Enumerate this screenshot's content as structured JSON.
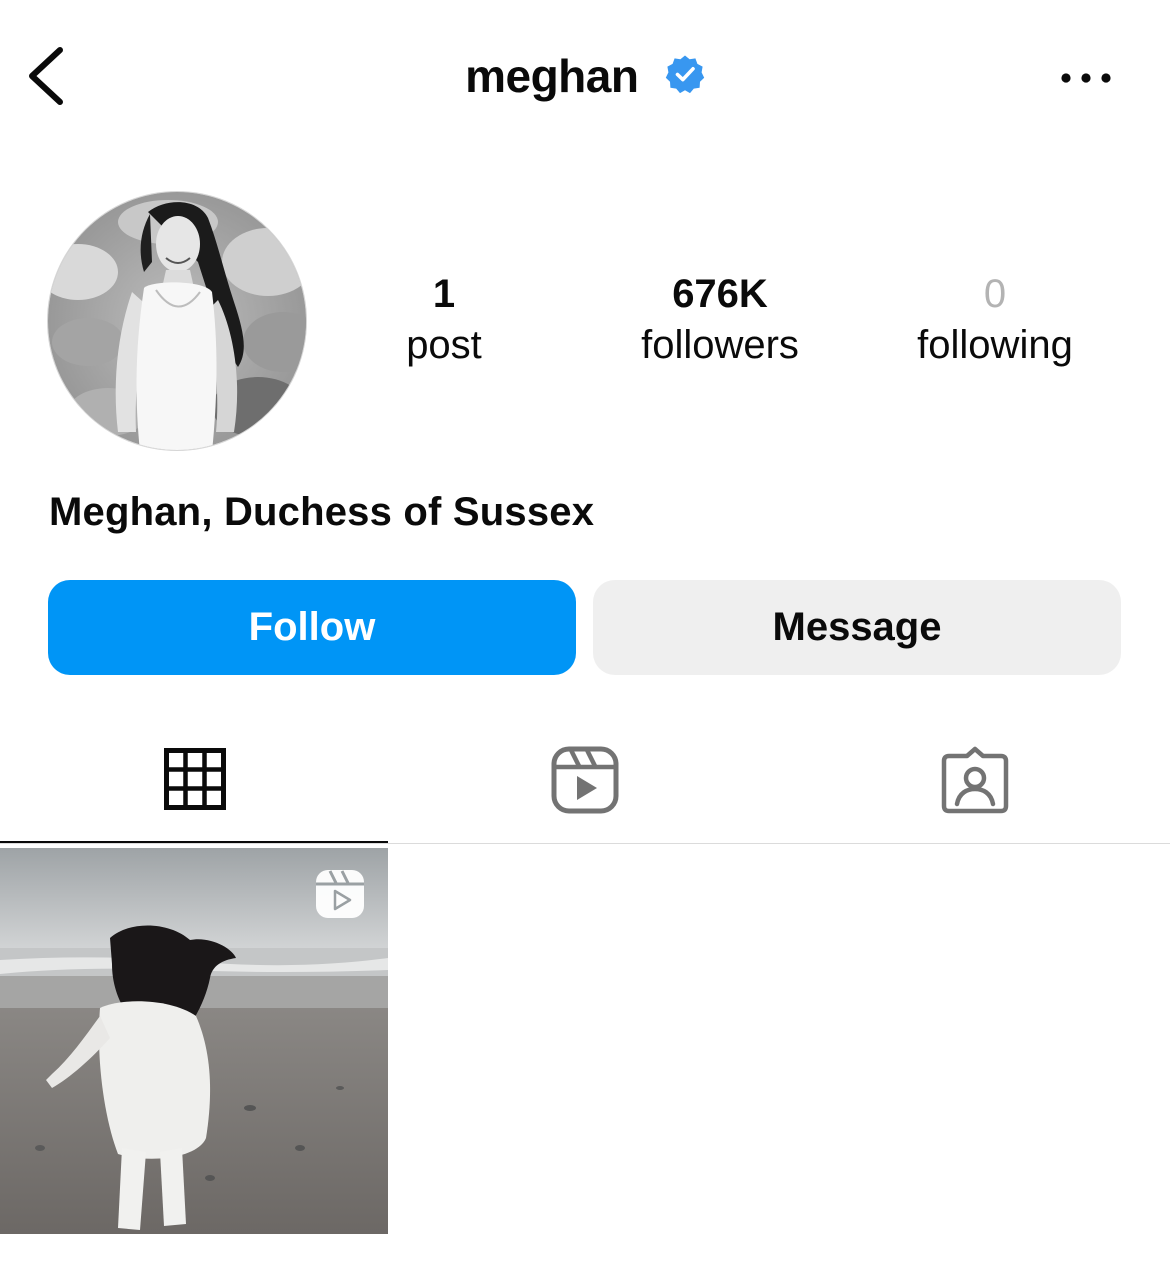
{
  "header": {
    "username": "meghan",
    "verified": true,
    "back_icon": "chevron-left-icon",
    "more_icon": "more-horizontal-icon",
    "verified_color": "#3897f0"
  },
  "profile": {
    "avatar_alt": "profile-photo",
    "full_name": "Meghan, Duchess of Sussex",
    "stats": {
      "posts": {
        "count": "1",
        "label": "post"
      },
      "followers": {
        "count": "676K",
        "label": "followers"
      },
      "following": {
        "count": "0",
        "label": "following"
      }
    }
  },
  "actions": {
    "follow_label": "Follow",
    "message_label": "Message",
    "follow_color": "#0095f6",
    "message_color": "#efefef"
  },
  "tabs": [
    {
      "name": "posts",
      "icon": "grid-icon",
      "active": true
    },
    {
      "name": "reels",
      "icon": "reels-icon",
      "active": false
    },
    {
      "name": "tagged",
      "icon": "tagged-person-icon",
      "active": false
    }
  ],
  "grid": {
    "posts": [
      {
        "type": "reel",
        "badge_icon": "reels-icon"
      }
    ]
  }
}
